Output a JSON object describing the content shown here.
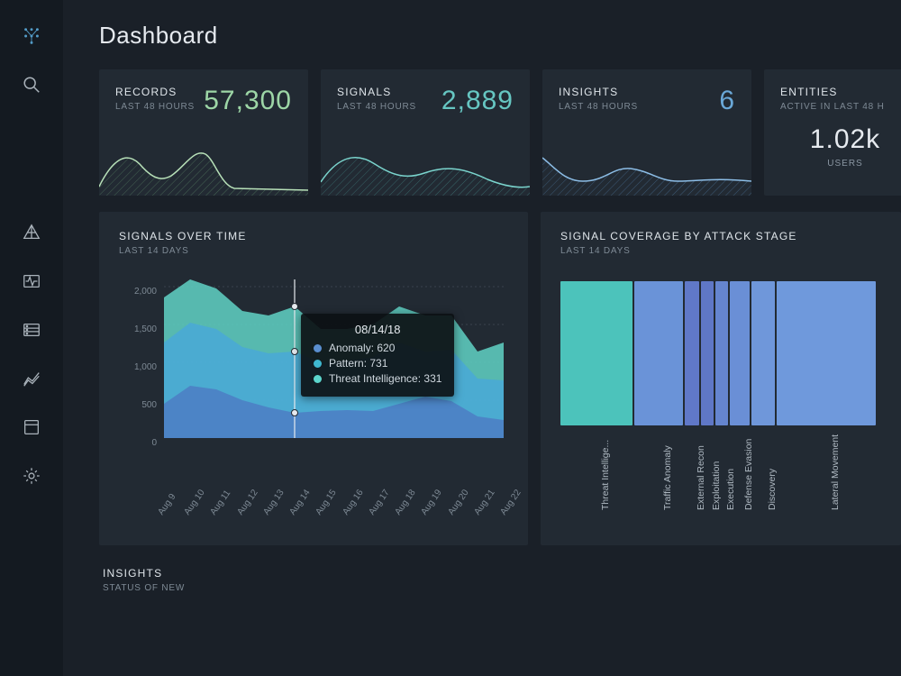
{
  "page": {
    "title": "Dashboard"
  },
  "cards": {
    "records": {
      "label": "RECORDS",
      "sublabel": "LAST 48 HOURS",
      "value": "57,300"
    },
    "signals": {
      "label": "SIGNALS",
      "sublabel": "LAST 48 HOURS",
      "value": "2,889"
    },
    "insights": {
      "label": "INSIGHTS",
      "sublabel": "LAST 48 HOURS",
      "value": "6"
    },
    "entities": {
      "label": "ENTITIES",
      "sublabel": "ACTIVE IN LAST 48 H",
      "value": "1.02k",
      "unit": "USERS"
    }
  },
  "signals_over_time": {
    "title": "SIGNALS OVER TIME",
    "subtitle": "LAST 14 DAYS",
    "y_ticks": [
      "0",
      "500",
      "1,000",
      "1,500",
      "2,000"
    ],
    "x_ticks": [
      "Aug 9",
      "Aug 10",
      "Aug 11",
      "Aug 12",
      "Aug 13",
      "Aug 14",
      "Aug 15",
      "Aug 16",
      "Aug 17",
      "Aug 18",
      "Aug 19",
      "Aug 20",
      "Aug 21",
      "Aug 22"
    ],
    "tooltip": {
      "date": "08/14/18",
      "rows": [
        {
          "label": "Anomaly",
          "value": "620"
        },
        {
          "label": "Pattern",
          "value": "731"
        },
        {
          "label": "Threat Intelligence",
          "value": "331"
        }
      ]
    }
  },
  "coverage": {
    "title": "SIGNAL COVERAGE BY ATTACK STAGE",
    "subtitle": "LAST 14 DAYS",
    "labels": [
      "Threat Intellige...",
      "Traffic Anomaly",
      "External Recon",
      "Exploitation",
      "Execution",
      "Defense Evasion",
      "Discovery",
      "Lateral Movement"
    ]
  },
  "insights_section": {
    "title": "INSIGHTS",
    "subtitle": "STATUS OF NEW"
  },
  "chart_data": [
    {
      "type": "area",
      "title": "SIGNALS OVER TIME",
      "xlabel": "",
      "ylabel": "",
      "ylim": [
        0,
        2200
      ],
      "x": [
        "Aug 9",
        "Aug 10",
        "Aug 11",
        "Aug 12",
        "Aug 13",
        "Aug 14",
        "Aug 15",
        "Aug 16",
        "Aug 17",
        "Aug 18",
        "Aug 19",
        "Aug 20",
        "Aug 21",
        "Aug 22"
      ],
      "stacked": true,
      "series": [
        {
          "name": "Threat Intelligence",
          "values": [
            450,
            700,
            650,
            500,
            400,
            331,
            350,
            380,
            360,
            430,
            500,
            460,
            300,
            250
          ]
        },
        {
          "name": "Pattern",
          "values": [
            700,
            900,
            850,
            700,
            650,
            731,
            600,
            620,
            650,
            750,
            650,
            600,
            420,
            350
          ]
        },
        {
          "name": "Anomaly",
          "values": [
            650,
            600,
            550,
            500,
            520,
            620,
            430,
            420,
            440,
            520,
            400,
            440,
            330,
            500
          ]
        }
      ],
      "tooltip_point": {
        "x": "Aug 14",
        "Anomaly": 620,
        "Pattern": 731,
        "Threat Intelligence": 331
      }
    },
    {
      "type": "bar",
      "title": "SIGNAL COVERAGE BY ATTACK STAGE",
      "categories": [
        "Threat Intelligence",
        "Traffic Anomaly",
        "External Recon",
        "Exploitation",
        "Execution",
        "Defense Evasion",
        "Discovery",
        "Lateral Movement"
      ],
      "widths": [
        80,
        54,
        16,
        14,
        14,
        22,
        26,
        110
      ],
      "colors": [
        "#4cc3bb",
        "#6a93d8",
        "#6078c8",
        "#5f77c6",
        "#6585cf",
        "#6a8fd6",
        "#6f97da",
        "#6f99dc"
      ],
      "note": "All bars share the same height; width encodes coverage share."
    }
  ]
}
